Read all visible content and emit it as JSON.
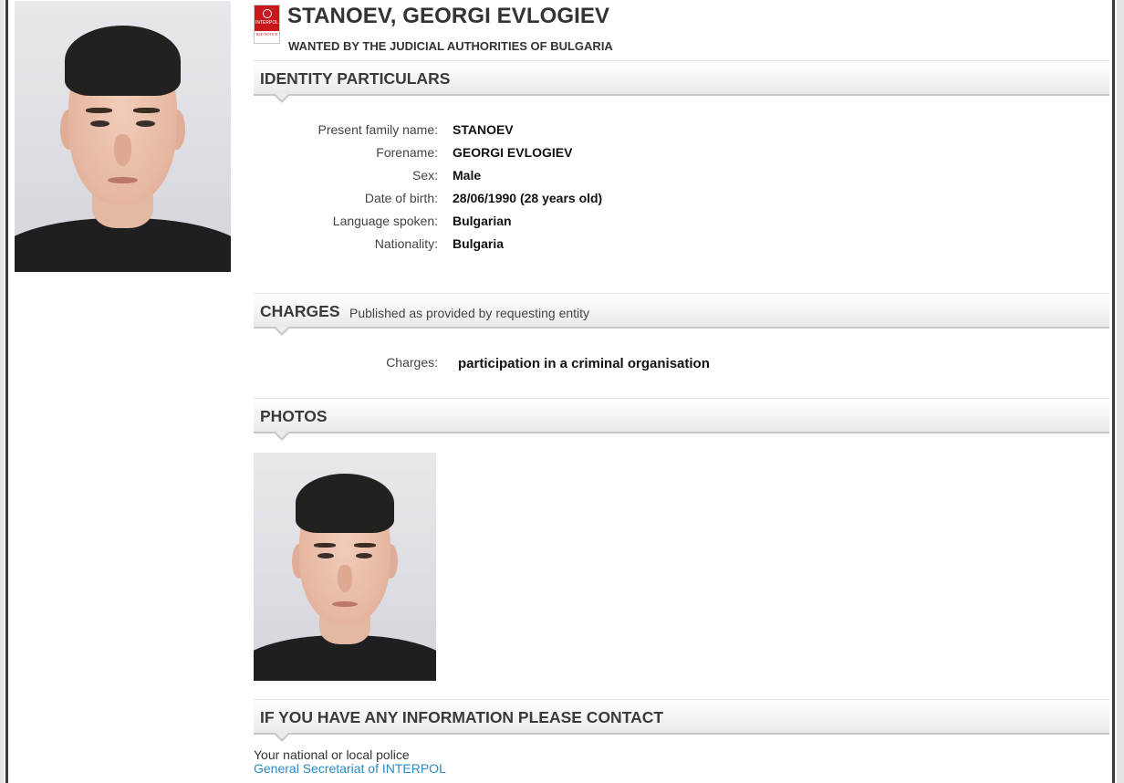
{
  "notice": {
    "name": "STANOEV, GEORGI EVLOGIEV",
    "wanted_by": "WANTED BY THE JUDICIAL AUTHORITIES OF BULGARIA",
    "badge_top": "INTERPOL",
    "badge_bottom": "RED NOTICE"
  },
  "identity": {
    "section_title": "IDENTITY PARTICULARS",
    "rows": [
      {
        "label": "Present family name:",
        "value": "STANOEV"
      },
      {
        "label": "Forename:",
        "value": "GEORGI EVLOGIEV"
      },
      {
        "label": "Sex:",
        "value": "Male"
      },
      {
        "label": "Date of birth:",
        "value": "28/06/1990 (28 years old)"
      },
      {
        "label": "Language spoken:",
        "value": "Bulgarian"
      },
      {
        "label": "Nationality:",
        "value": "Bulgaria"
      }
    ]
  },
  "charges": {
    "section_title": "CHARGES",
    "note": "Published as provided by requesting entity",
    "label": "Charges:",
    "value": "participation in a criminal organisation"
  },
  "photos": {
    "section_title": "PHOTOS"
  },
  "contact": {
    "section_title": "IF YOU HAVE ANY INFORMATION PLEASE CONTACT",
    "police": "Your national or local police",
    "link": "General Secretariat of INTERPOL"
  },
  "colors": {
    "link": "#2a8bc2",
    "badge_red": "#c8171d",
    "frame_dark": "#3a3a3a"
  }
}
